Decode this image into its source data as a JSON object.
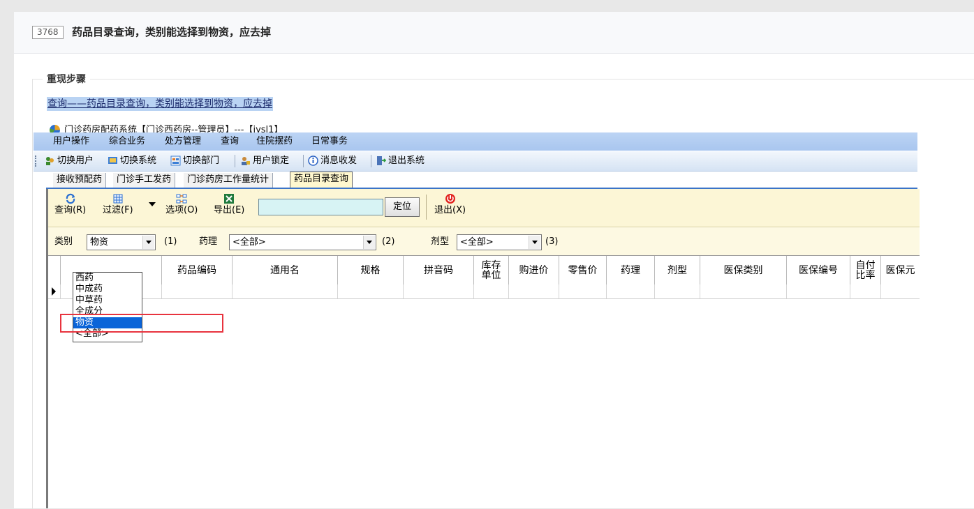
{
  "issue": {
    "id": "3768",
    "title": "药品目录查询，类别能选择到物资，应去掉"
  },
  "section": {
    "legend": "重现步骤",
    "steps_text": "查询——药品目录查询，类别能选择到物资，应去掉"
  },
  "app": {
    "window_title": "门诊药房配药系统【门诊西药房--管理员】---【jysl1】",
    "menu": [
      "用户操作",
      "综合业务",
      "处方管理",
      "查询",
      "住院摆药",
      "日常事务"
    ],
    "toolbar": [
      "切换用户",
      "切换系统",
      "切换部门",
      "用户锁定",
      "消息收发",
      "退出系统"
    ],
    "tabs": [
      "接收预配药",
      "门诊手工发药",
      "门诊药房工作量统计",
      "药品目录查询"
    ],
    "active_tab": "药品目录查询",
    "actions": {
      "query": "查询(R)",
      "filter": "过滤(F)",
      "options": "选项(O)",
      "export": "导出(E)",
      "locate": "定位",
      "exit": "退出(X)"
    },
    "filters": {
      "category_label": "类别",
      "category_value": "物资",
      "category_hotkey": "(1)",
      "pharmacology_label": "药理",
      "pharmacology_value": "<全部>",
      "pharmacology_hotkey": "(2)",
      "dosage_label": "剂型",
      "dosage_value": "<全部>",
      "dosage_hotkey": "(3)"
    },
    "category_options": [
      "西药",
      "中成药",
      "中草药",
      "全成分",
      "物资",
      "<全部>"
    ],
    "selected_option": "物资",
    "columns": [
      "药品编码",
      "通用名",
      "规格",
      "拼音码",
      "库存\n单位",
      "购进价",
      "零售价",
      "药理",
      "剂型",
      "医保类别",
      "医保编号",
      "自付\n比率",
      "医保元"
    ]
  },
  "colors": {
    "highlight_border": "#e8333e",
    "selected_option_bg": "#0a64d8",
    "menubar": "#b4cdf2",
    "panel_bg": "#fdf9e2"
  }
}
